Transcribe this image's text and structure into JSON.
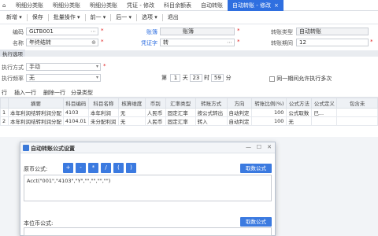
{
  "tabs": [
    {
      "label": "明细分类账"
    },
    {
      "label": "明细分类账"
    },
    {
      "label": "明细分类账"
    },
    {
      "label": "凭证 - 修改"
    },
    {
      "label": "科目余额表"
    },
    {
      "label": "自动转账"
    },
    {
      "label": "自动转账 - 修改"
    }
  ],
  "toolbar": {
    "new_label": "新增",
    "save_label": "保存",
    "batch_label": "批量操作",
    "prev_label": "前一",
    "next_label": "后一",
    "options_label": "选项",
    "exit_label": "退出"
  },
  "form": {
    "code_label": "编码",
    "code_value": "GLTB001",
    "name_label": "名称",
    "name_value": "年终结转",
    "book_label": "账簿",
    "book_value": "账簿",
    "voucher_label": "凭证字",
    "voucher_value": "转",
    "transfer_type_label": "转账类型",
    "transfer_type_value": "自动转账",
    "period_label": "转账期间",
    "period_value": "12"
  },
  "exec": {
    "section_label": "执行选项",
    "method_label": "执行方式",
    "method_value": "手动",
    "freq_label": "执行频率",
    "freq_value": "无",
    "day_prefix": "第",
    "day_value": "1",
    "day_unit": "天",
    "hour_value": "23",
    "hour_unit": "时",
    "minute_value": "59",
    "minute_unit": "分",
    "multi_label": "同一期间允许执行多次"
  },
  "row_actions": {
    "add_label": "行",
    "insert_label": "插入一行",
    "delete_label": "删除一行",
    "split_label": "分录类型"
  },
  "grid": {
    "headers": [
      "",
      "摘要",
      "科目编码",
      "科目名称",
      "核算维度",
      "币别",
      "汇率类型",
      "转账方式",
      "方向",
      "转账比例(%)",
      "公式方法",
      "公式定义",
      "包含未"
    ],
    "rows": [
      [
        "1",
        "本年利润结转利润分配",
        "4103",
        "本年利润",
        "无",
        "人民币",
        "固定汇率",
        "按公式转出",
        "自动判定",
        "100",
        "公式取数",
        "已...",
        ""
      ],
      [
        "2",
        "本年利润结转利润分配",
        "4104.01",
        "未分配利润",
        "无",
        "人民币",
        "固定汇率",
        "转入",
        "自动判定",
        "100",
        "无",
        "",
        ""
      ]
    ]
  },
  "dialog": {
    "title": "自动转账公式设置",
    "orig_label": "原币公式:",
    "ops": [
      "+",
      "-",
      "*",
      "/",
      "(",
      ")"
    ],
    "fetch_label": "取数公式",
    "formula_value": "Acct(\"001\",\"4103\",\"Y\",\"\",\"\",\"\",\"\")",
    "local_label": "本位币公式:"
  }
}
